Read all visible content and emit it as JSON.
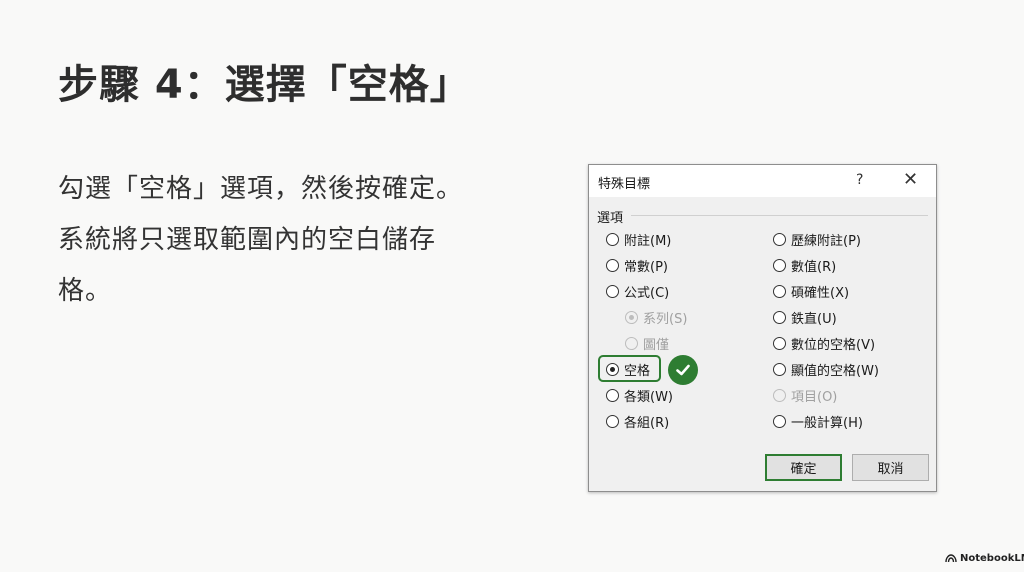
{
  "slide": {
    "title": "步驟 4：選擇「空格」",
    "body": "勾選「空格」選項，然後按確定。系統將只選取範圍內的空白儲存格。"
  },
  "dialog": {
    "title": "特殊目標",
    "help_label": "?",
    "close_label": "✕",
    "group_label": "選項",
    "left_options": [
      {
        "label": "附註(M)",
        "checked": false,
        "disabled": false
      },
      {
        "label": "常數(P)",
        "checked": false,
        "disabled": false
      },
      {
        "label": "公式(C)",
        "checked": false,
        "disabled": false
      },
      {
        "label": "系列(S)",
        "checked": true,
        "disabled": true
      },
      {
        "label": "圖僅",
        "checked": false,
        "disabled": true
      },
      {
        "label": "空格",
        "checked": true,
        "disabled": false
      },
      {
        "label": "各類(W)",
        "checked": false,
        "disabled": false
      },
      {
        "label": "各組(R)",
        "checked": false,
        "disabled": false
      }
    ],
    "right_options": [
      {
        "label": "歷練附註(P)",
        "checked": false,
        "disabled": false
      },
      {
        "label": "數值(R)",
        "checked": false,
        "disabled": false
      },
      {
        "label": "碩確性(X)",
        "checked": false,
        "disabled": false
      },
      {
        "label": "鉄直(U)",
        "checked": false,
        "disabled": false
      },
      {
        "label": "數位的空格(V)",
        "checked": false,
        "disabled": false
      },
      {
        "label": "顯值的空格(W)",
        "checked": false,
        "disabled": false
      },
      {
        "label": "項目(O)",
        "checked": false,
        "disabled": true
      },
      {
        "label": "一般計算(H)",
        "checked": false,
        "disabled": false
      }
    ],
    "ok_label": "確定",
    "cancel_label": "取消",
    "accent_color": "#2e7d32"
  },
  "branding": {
    "name": "NotebookLM"
  }
}
